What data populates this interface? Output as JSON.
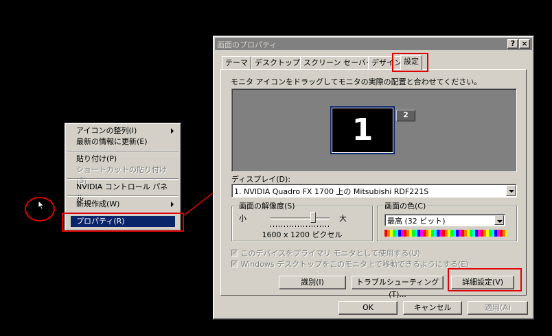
{
  "context_menu": {
    "items": [
      {
        "label": "アイコンの整列(I)",
        "submenu": true,
        "enabled": true
      },
      {
        "label": "最新の情報に更新(E)",
        "submenu": false,
        "enabled": true
      },
      {
        "label": "貼り付け(P)",
        "submenu": false,
        "enabled": true
      },
      {
        "label": "ショートカットの貼り付け(S)",
        "submenu": false,
        "enabled": false
      },
      {
        "label": "NVIDIA コントロール パネル",
        "submenu": false,
        "enabled": true
      },
      {
        "label": "新規作成(W)",
        "submenu": true,
        "enabled": true
      },
      {
        "label": "プロパティ(R)",
        "submenu": false,
        "enabled": true,
        "selected": true
      }
    ]
  },
  "dialog": {
    "title": "画面のプロパティ",
    "help_button": "?",
    "close_button": "×",
    "tabs": [
      {
        "label": "テーマ",
        "active": false
      },
      {
        "label": "デスクトップ",
        "active": false
      },
      {
        "label": "スクリーン セーバー",
        "active": false
      },
      {
        "label": "デザイン",
        "active": false
      },
      {
        "label": "設定",
        "active": true
      }
    ],
    "instruction": "モニタ アイコンをドラッグしてモニタの実際の配置と合わせてください。",
    "monitors": [
      {
        "number": "1",
        "primary": true
      },
      {
        "number": "2",
        "primary": false
      }
    ],
    "display_label": "ディスプレイ(D):",
    "display_value": "1. NVIDIA Quadro FX 1700 上の Mitsubishi RDF221S",
    "resolution": {
      "legend": "画面の解像度(S)",
      "min_label": "小",
      "max_label": "大",
      "value": "1600 x 1200 ピクセル",
      "slider_fraction": 0.72
    },
    "color": {
      "legend": "画面の色(C)",
      "value": "最高 (32 ビット)"
    },
    "checkboxes": [
      {
        "label": "このデバイスをプライマリ モニタとして使用する(U)",
        "checked": true,
        "enabled": false
      },
      {
        "label": "Windows デスクトップをこのモニタ上で移動できるようにする(E)",
        "checked": true,
        "enabled": false
      }
    ],
    "buttons": {
      "identify": "識別(I)",
      "troubleshoot": "トラブルシューティング(T)...",
      "advanced": "詳細設定(V)",
      "ok": "OK",
      "cancel": "キャンセル",
      "apply": "適用(A)"
    }
  },
  "colors": {
    "annotation_red": "#e00000",
    "title_inactive": "#808080",
    "selection": "#0a246a",
    "monitor_bg": "#808080",
    "dialog_face": "#d4d0c8"
  }
}
